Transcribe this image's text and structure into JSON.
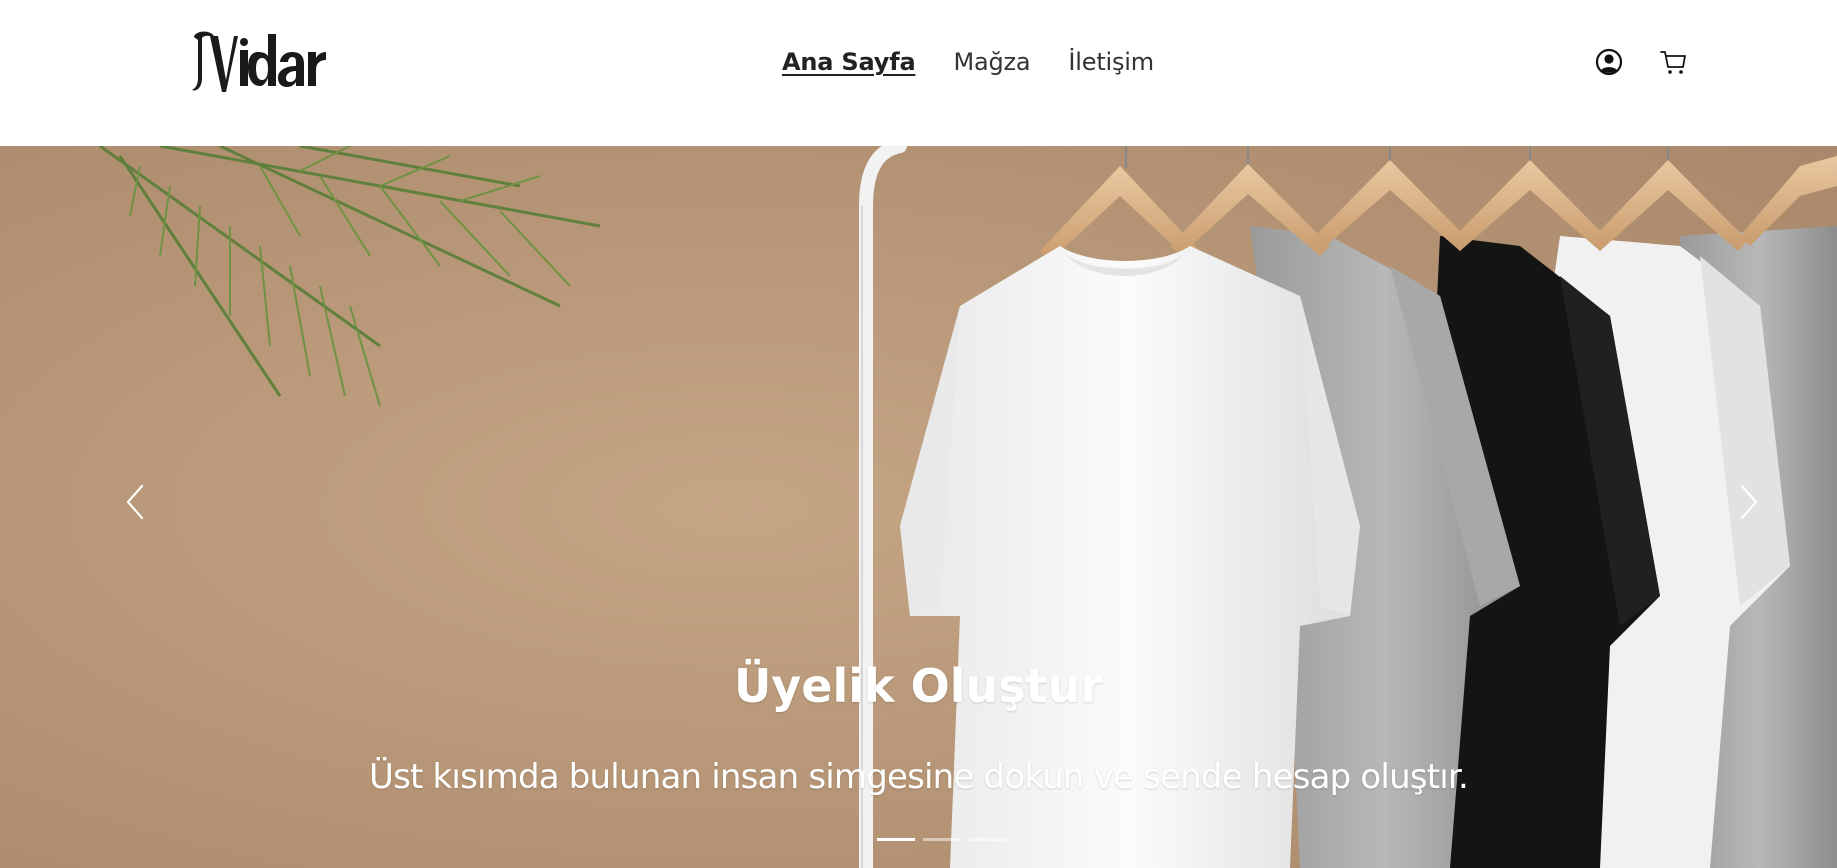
{
  "brand": {
    "logo_text": "Vidar"
  },
  "nav": {
    "items": [
      {
        "label": "Ana Sayfa",
        "active": true
      },
      {
        "label": "Mağza",
        "active": false
      },
      {
        "label": "İletişim",
        "active": false
      }
    ]
  },
  "header_icons": [
    "user-circle-icon",
    "cart-icon"
  ],
  "carousel": {
    "slide_count": 3,
    "active_index": 0,
    "title": "Üyelik Oluştur",
    "text": "Üst kısımda bulunan insan simgesine dokun ve sende hesap oluştır.",
    "prev_icon": "chevron-left-icon",
    "next_icon": "chevron-right-icon"
  },
  "colors": {
    "background_wall": "#b8987a",
    "caption_text": "#ffffff",
    "nav_text": "#333333"
  }
}
